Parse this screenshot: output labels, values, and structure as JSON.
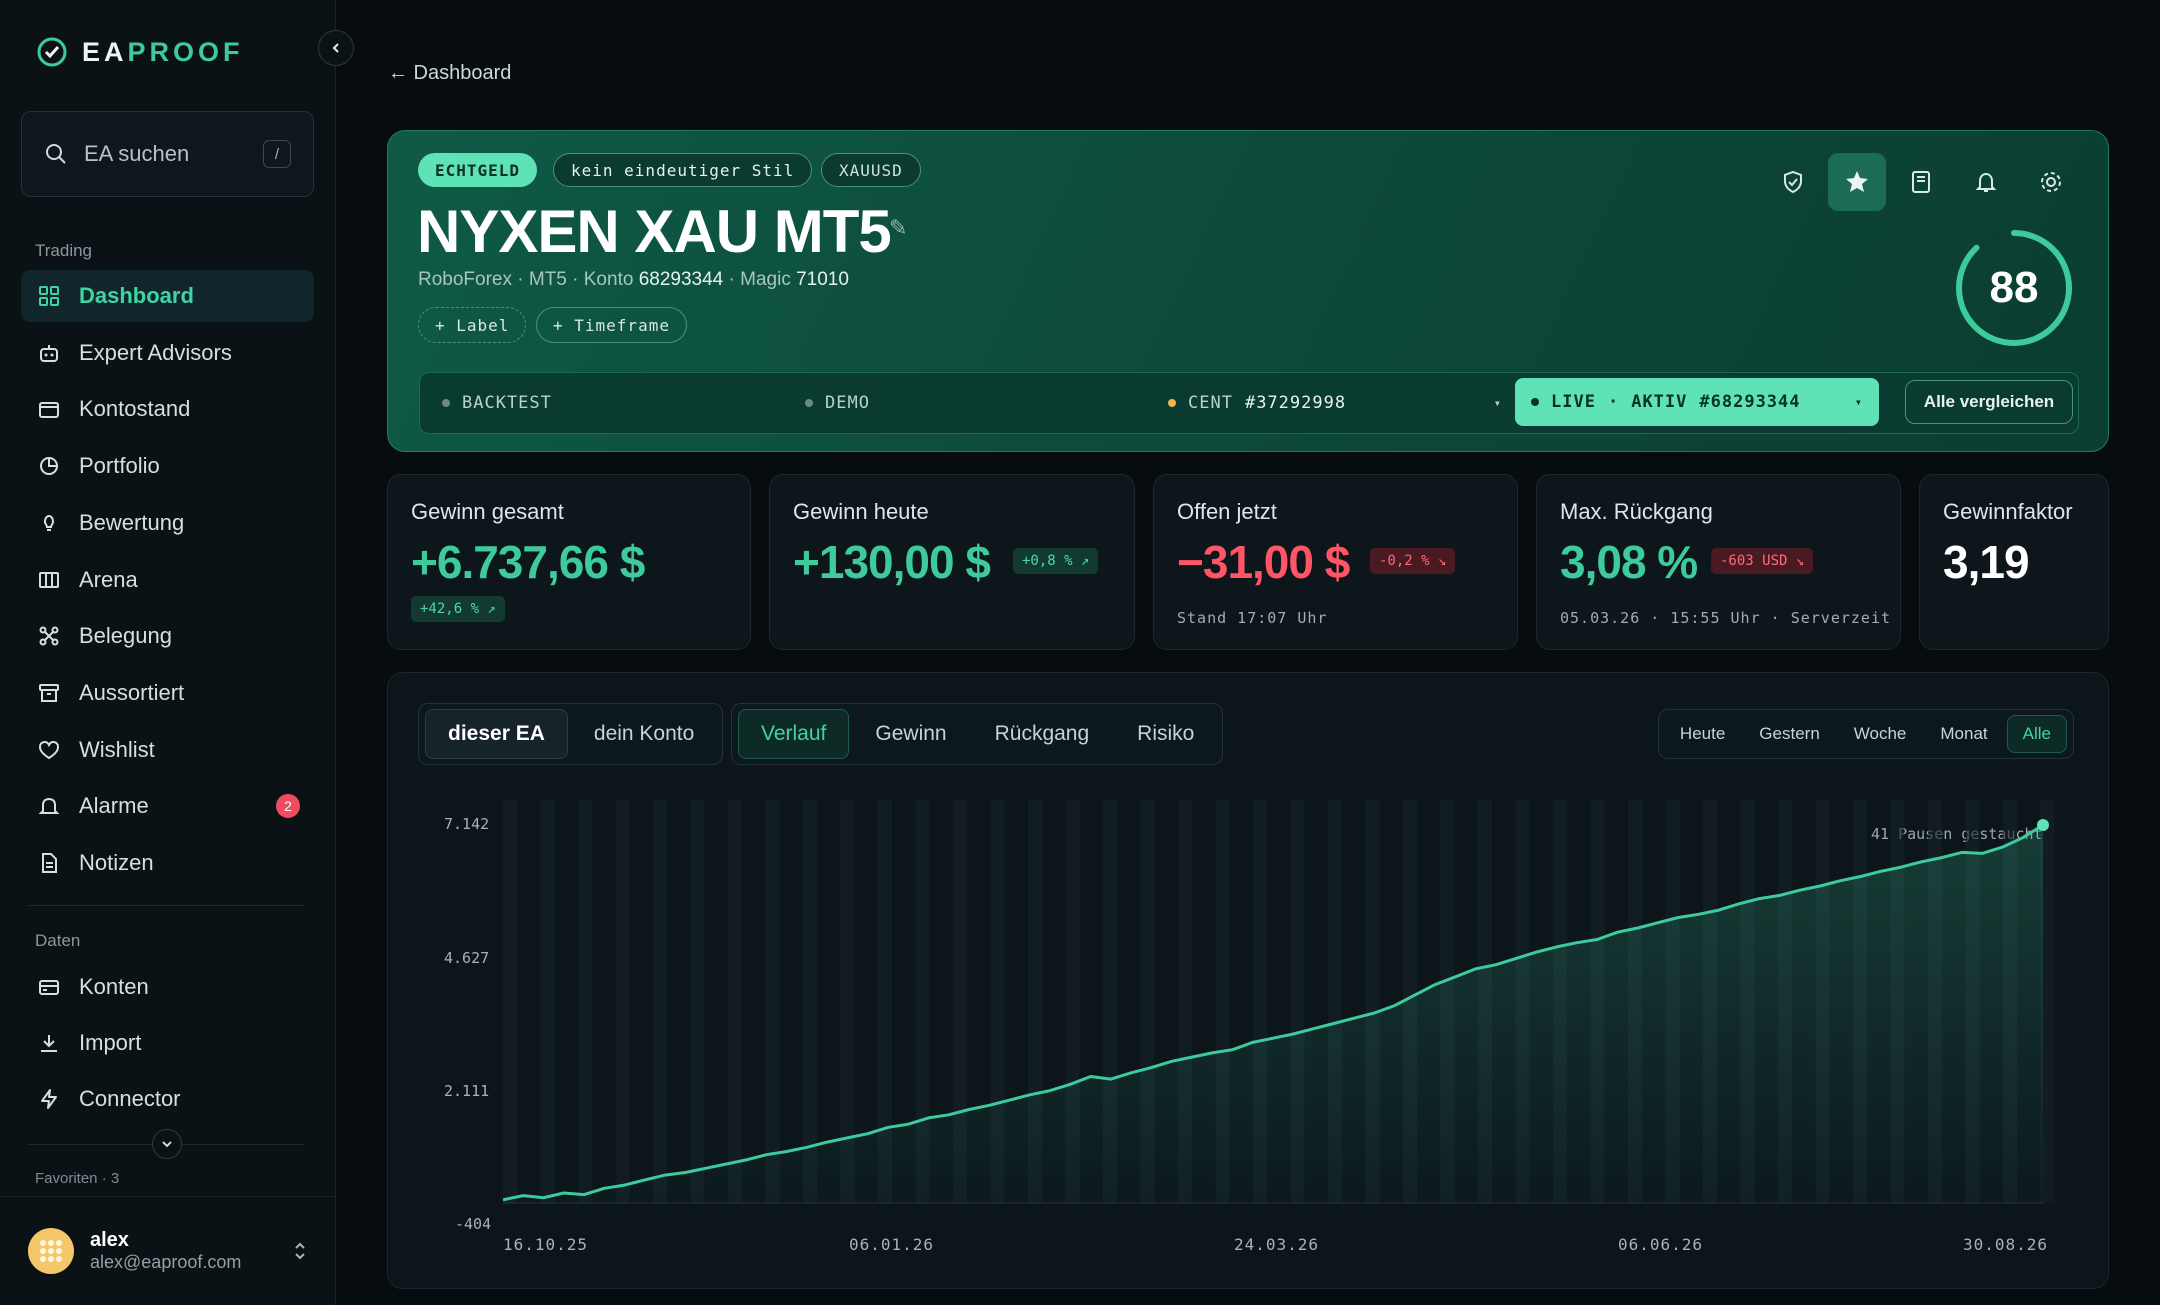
{
  "sidebar": {
    "logo_part1": "EA",
    "logo_part2": "PROOF",
    "search_placeholder": "EA suchen",
    "search_shortcut": "/",
    "section_trading": "Trading",
    "trading_items": [
      {
        "label": "Dashboard",
        "icon": "grid-icon",
        "active": true
      },
      {
        "label": "Expert Advisors",
        "icon": "robot-icon"
      },
      {
        "label": "Kontostand",
        "icon": "wallet-icon"
      },
      {
        "label": "Portfolio",
        "icon": "pie-icon"
      },
      {
        "label": "Bewertung",
        "icon": "bulb-icon"
      },
      {
        "label": "Arena",
        "icon": "columns-icon"
      },
      {
        "label": "Belegung",
        "icon": "network-icon"
      },
      {
        "label": "Aussortiert",
        "icon": "archive-icon"
      },
      {
        "label": "Wishlist",
        "icon": "heart-icon"
      },
      {
        "label": "Alarme",
        "icon": "bell-icon",
        "badge": "2"
      },
      {
        "label": "Notizen",
        "icon": "note-icon"
      }
    ],
    "section_daten": "Daten",
    "daten_items": [
      {
        "label": "Konten",
        "icon": "card-icon"
      },
      {
        "label": "Import",
        "icon": "download-icon"
      },
      {
        "label": "Connector",
        "icon": "bolt-icon"
      }
    ],
    "favoriten": "Favoriten · 3",
    "user": {
      "name": "alex",
      "email": "alex@eaproof.com"
    }
  },
  "breadcrumb": "← Dashboard",
  "hero": {
    "tags": [
      "ECHTGELD",
      "kein eindeutiger Stil",
      "XAUUSD"
    ],
    "title": "NYXEN XAU MT5",
    "sub_broker": "RoboForex · MT5 · Konto ",
    "sub_account": "68293344",
    "sub_magic_label": " · Magic ",
    "sub_magic": "71010",
    "add_label": "+ Label",
    "add_timeframe": "+ Timeframe",
    "score": "88",
    "score_fraction": 0.88,
    "icons": [
      "shield-icon",
      "star-icon",
      "book-icon",
      "bell-icon",
      "gear-icon"
    ],
    "envs": {
      "backtest": "BACKTEST",
      "demo": "DEMO",
      "cent": "CENT",
      "cent_id": "#37292998",
      "live": "LIVE",
      "live_sep": "·",
      "live_status": "AKTIV",
      "live_id": "#68293344",
      "compare": "Alle vergleichen"
    }
  },
  "stats": [
    {
      "label": "Gewinn gesamt",
      "value": "+6.737,66 $",
      "chip": "+42,6 % ↗",
      "color": "g"
    },
    {
      "label": "Gewinn heute",
      "value": "+130,00 $",
      "chip": "+0,8 % ↗",
      "color": "g"
    },
    {
      "label": "Offen jetzt",
      "value": "−31,00 $",
      "chip": "-0,2 % ↘",
      "note": "Stand 17:07 Uhr",
      "color": "r"
    },
    {
      "label": "Max. Rückgang",
      "value": "3,08 %",
      "chip": "-603 USD ↘",
      "note": "05.03.26 · 15:55 Uhr · Serverzeit",
      "color": "g"
    },
    {
      "label": "Gewinnfaktor",
      "value": "3,19",
      "color": "w"
    }
  ],
  "chart_panel": {
    "scope_tabs": [
      "dieser EA",
      "dein Konto"
    ],
    "metric_tabs": [
      "Verlauf",
      "Gewinn",
      "Rückgang",
      "Risiko"
    ],
    "range_tabs": [
      "Heute",
      "Gestern",
      "Woche",
      "Monat",
      "Alle"
    ],
    "pausen_note": "41 Pausen gestaucht"
  },
  "chart_data": {
    "type": "line",
    "ytick_labels": [
      "7.142",
      "4.627",
      "2.111",
      "-404"
    ],
    "yticks": [
      7142,
      4627,
      2111,
      -404
    ],
    "ylim": [
      -404,
      7142
    ],
    "xtick_labels": [
      "16.10.25",
      "06.01.26",
      "24.03.26",
      "06.06.26",
      "30.08.26"
    ],
    "grid": true,
    "series": [
      {
        "values": [
          0,
          80,
          40,
          130,
          100,
          220,
          280,
          380,
          470,
          520,
          600,
          680,
          760,
          860,
          920,
          1000,
          1100,
          1180,
          1260,
          1380,
          1440,
          1560,
          1620,
          1720,
          1800,
          1900,
          2000,
          2080,
          2200,
          2350,
          2300,
          2420,
          2520,
          2640,
          2720,
          2800,
          2860,
          3000,
          3080,
          3160,
          3260,
          3360,
          3460,
          3560,
          3700,
          3900,
          4100,
          4250,
          4400,
          4480,
          4600,
          4720,
          4820,
          4900,
          4960,
          5100,
          5180,
          5280,
          5380,
          5440,
          5520,
          5640,
          5740,
          5800,
          5900,
          5980,
          6080,
          6160,
          6260,
          6340,
          6440,
          6520,
          6620,
          6600,
          6720,
          6900,
          7142
        ]
      }
    ]
  }
}
